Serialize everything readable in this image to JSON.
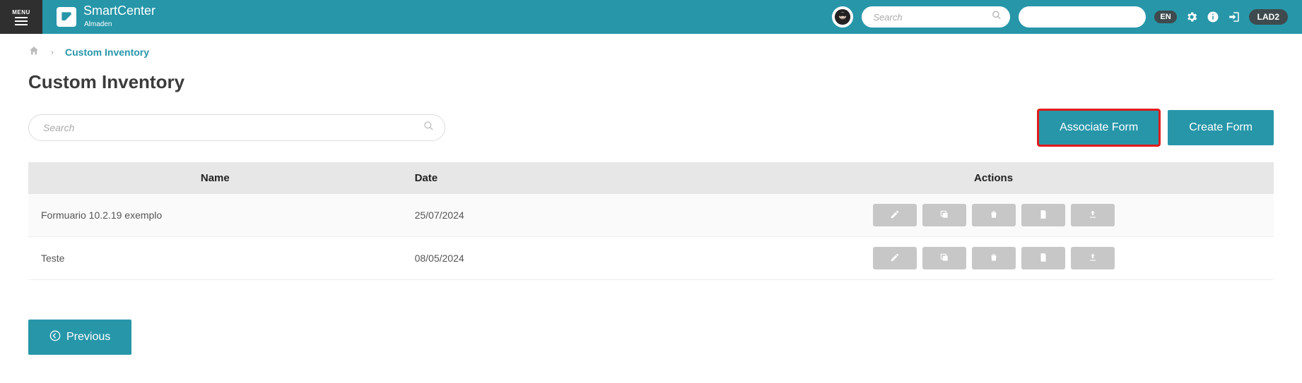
{
  "header": {
    "menu_label": "MENU",
    "brand": "SmartCenter",
    "brand_sub": "Almaden",
    "search_placeholder": "Search",
    "lang": "EN",
    "env": "LAD2"
  },
  "breadcrumb": {
    "current": "Custom Inventory"
  },
  "page": {
    "title": "Custom Inventory",
    "search_placeholder": "Search",
    "associate_btn": "Associate Form",
    "create_btn": "Create Form",
    "previous_btn": "Previous"
  },
  "table": {
    "headers": {
      "name": "Name",
      "date": "Date",
      "actions": "Actions"
    },
    "rows": [
      {
        "name": "Formuario 10.2.19 exemplo",
        "date": "25/07/2024"
      },
      {
        "name": "Teste",
        "date": "08/05/2024"
      }
    ]
  }
}
